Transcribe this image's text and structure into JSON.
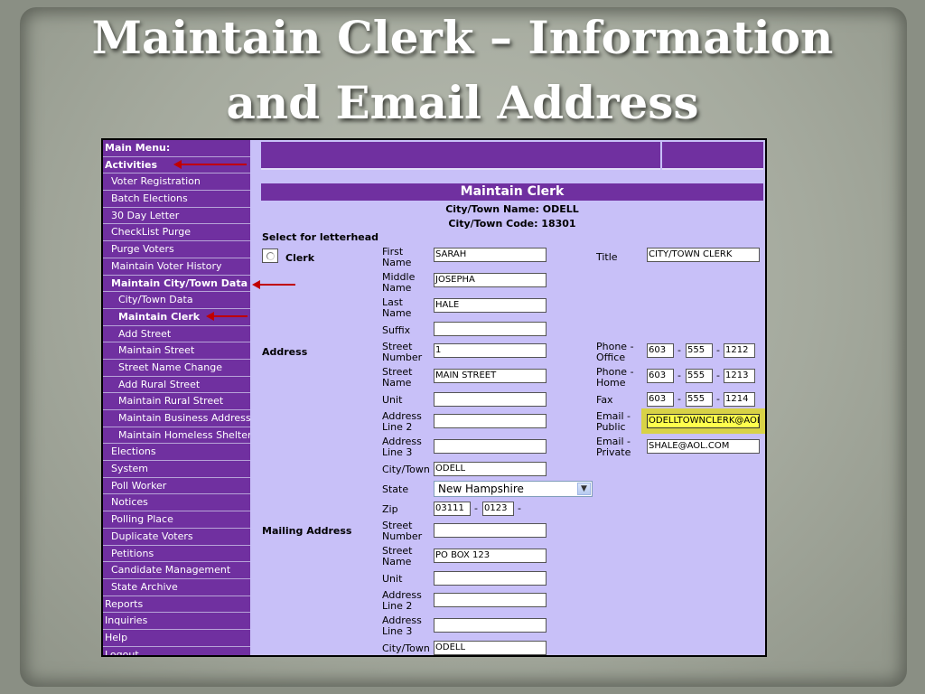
{
  "slide": {
    "title_line1": "Maintain Clerk – Information",
    "title_line2": "and Email Address"
  },
  "menu": [
    {
      "label": "Main Menu:",
      "level": 0,
      "bold": true
    },
    {
      "label": "Activities",
      "level": 0,
      "bold": true
    },
    {
      "label": "Voter Registration",
      "level": 1,
      "bold": false
    },
    {
      "label": "Batch Elections",
      "level": 1,
      "bold": false
    },
    {
      "label": "30 Day Letter",
      "level": 1,
      "bold": false
    },
    {
      "label": "CheckList Purge",
      "level": 1,
      "bold": false
    },
    {
      "label": "Purge Voters",
      "level": 1,
      "bold": false
    },
    {
      "label": "Maintain Voter History",
      "level": 1,
      "bold": false
    },
    {
      "label": "Maintain City/Town Data",
      "level": 1,
      "bold": true
    },
    {
      "label": "City/Town Data",
      "level": 2,
      "bold": false
    },
    {
      "label": "Maintain Clerk",
      "level": 2,
      "bold": true
    },
    {
      "label": "Add Street",
      "level": 2,
      "bold": false
    },
    {
      "label": "Maintain Street",
      "level": 2,
      "bold": false
    },
    {
      "label": "Street Name Change",
      "level": 2,
      "bold": false
    },
    {
      "label": "Add Rural Street",
      "level": 2,
      "bold": false
    },
    {
      "label": "Maintain Rural Street",
      "level": 2,
      "bold": false
    },
    {
      "label": "Maintain Business Address",
      "level": 2,
      "bold": false
    },
    {
      "label": "Maintain Homeless Shelter",
      "level": 2,
      "bold": false
    },
    {
      "label": "Elections",
      "level": 1,
      "bold": false
    },
    {
      "label": "System",
      "level": 1,
      "bold": false
    },
    {
      "label": "Poll Worker",
      "level": 1,
      "bold": false
    },
    {
      "label": "Notices",
      "level": 1,
      "bold": false
    },
    {
      "label": "Polling Place",
      "level": 1,
      "bold": false
    },
    {
      "label": "Duplicate Voters",
      "level": 1,
      "bold": false
    },
    {
      "label": "Petitions",
      "level": 1,
      "bold": false
    },
    {
      "label": "Candidate Management",
      "level": 1,
      "bold": false
    },
    {
      "label": "State Archive",
      "level": 1,
      "bold": false
    },
    {
      "label": "Reports",
      "level": 0,
      "bold": false
    },
    {
      "label": "Inquiries",
      "level": 0,
      "bold": false
    },
    {
      "label": "Help",
      "level": 0,
      "bold": false
    },
    {
      "label": "Logout",
      "level": 0,
      "bold": false
    }
  ],
  "form": {
    "heading": "Maintain Clerk",
    "city_name": "City/Town Name: ODELL",
    "city_code": "City/Town Code: 18301",
    "letterhead_label": "Select for letterhead",
    "clerk_label": "Clerk",
    "address_section": "Address",
    "mailing_section": "Mailing Address",
    "labels": {
      "first_name": [
        "First",
        "Name"
      ],
      "middle_name": [
        "Middle",
        "Name"
      ],
      "last_name": [
        "Last",
        "Name"
      ],
      "suffix": "Suffix",
      "street_number": [
        "Street",
        "Number"
      ],
      "street_name": [
        "Street",
        "Name"
      ],
      "unit": "Unit",
      "address_line2": [
        "Address",
        "Line 2"
      ],
      "address_line3": [
        "Address",
        "Line 3"
      ],
      "city_town": "City/Town",
      "state": "State",
      "zip": "Zip",
      "title": "Title",
      "phone_office": [
        "Phone -",
        "Office"
      ],
      "phone_home": [
        "Phone -",
        "Home"
      ],
      "fax": "Fax",
      "email_public": [
        "Email -",
        "Public"
      ],
      "email_private": [
        "Email -",
        "Private"
      ]
    },
    "values": {
      "first_name": "SARAH",
      "middle_name": "JOSEPHA",
      "last_name": "HALE",
      "suffix": "",
      "street_number": "1",
      "street_name": "MAIN STREET",
      "unit": "",
      "address_line2": "",
      "address_line3": "",
      "city_town": "ODELL",
      "state": "New Hampshire",
      "zip": "03111",
      "zip4": "0123",
      "title": "CITY/TOWN CLERK",
      "phone_office": [
        "603",
        "555",
        "1212"
      ],
      "phone_home": [
        "603",
        "555",
        "1213"
      ],
      "fax": [
        "603",
        "555",
        "1214"
      ],
      "email_public": "ODELLTOWNCLERK@AOL.COM",
      "email_private": "SHALE@AOL.COM",
      "mail_street_number": "",
      "mail_street_name": "PO BOX 123",
      "mail_unit": "",
      "mail_address_line2": "",
      "mail_address_line3": "",
      "mail_city_town": "ODELL"
    },
    "dash": "-"
  },
  "colors": {
    "menu_bg": "#7030a0",
    "content_bg": "#c8c0f8",
    "arrow": "#c00000",
    "highlight": "#d8d246"
  }
}
